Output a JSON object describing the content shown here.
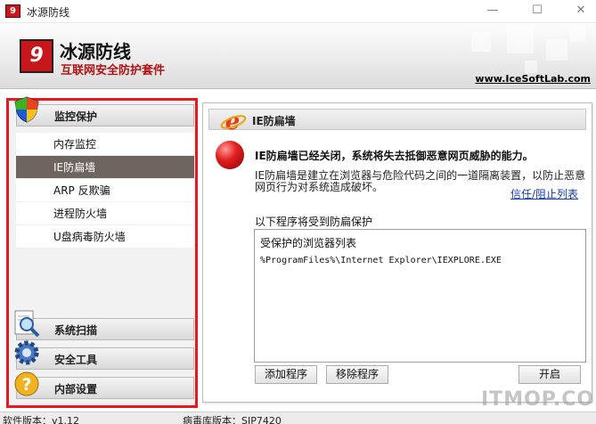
{
  "window": {
    "title": "冰源防线",
    "controls": {
      "minimize": "—",
      "maximize": "☐",
      "close": "✕"
    }
  },
  "header": {
    "logo_glyph": "9",
    "app_name": "冰源防线",
    "subtitle": "互联网安全防护套件",
    "url": "www.IceSoftLab.com"
  },
  "sidebar": {
    "groups": [
      {
        "label": "监控保护",
        "icon": "shield-icon"
      },
      {
        "label": "系统扫描",
        "icon": "magnifier-icon"
      },
      {
        "label": "安全工具",
        "icon": "gear-icon"
      },
      {
        "label": "内部设置",
        "icon": "help-icon"
      }
    ],
    "items": [
      {
        "label": "内存监控"
      },
      {
        "label": "IE防扁墙",
        "selected": true
      },
      {
        "label": "ARP 反欺骗"
      },
      {
        "label": "进程防火墙"
      },
      {
        "label": "U盘病毒防火墙"
      }
    ]
  },
  "main": {
    "header_title": "IE防扁墙",
    "warning_title": "IE防扁墙已经关闭，系统将失去抵御恶意网页威胁的能力。",
    "description": "IE防扁墙是建立在浏览器与危险代码之间的一道隔离装置，以防止恶意网页行为对系统造成破坏。",
    "trust_link": "信任/阻止列表",
    "list_label": "以下程序将受到防扁保护",
    "list_header": "受保护的浏览器列表",
    "list_rows": [
      "%ProgramFiles%\\Internet Explorer\\IEXPLORE.EXE"
    ],
    "buttons": {
      "add": "添加程序",
      "remove": "移除程序",
      "start": "开启"
    }
  },
  "status": {
    "version": "软件版本：v1.12",
    "db_version": "病毒库版本：SIP7420"
  },
  "watermark": "ITMOP.COM",
  "colors": {
    "highlight_border": "#e8191c",
    "selected_item": "#6e6460",
    "brand_red": "#c8161d",
    "link": "#1a3ea8"
  }
}
